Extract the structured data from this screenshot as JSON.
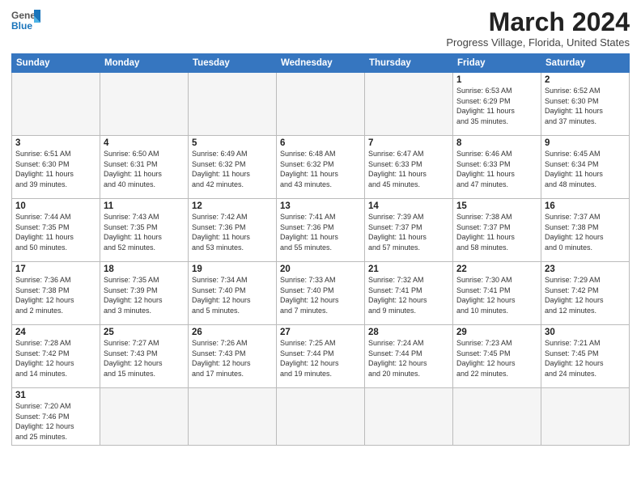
{
  "header": {
    "logo_line1": "General",
    "logo_line2": "Blue",
    "month_title": "March 2024",
    "subtitle": "Progress Village, Florida, United States"
  },
  "columns": [
    "Sunday",
    "Monday",
    "Tuesday",
    "Wednesday",
    "Thursday",
    "Friday",
    "Saturday"
  ],
  "weeks": [
    [
      {
        "day": "",
        "info": ""
      },
      {
        "day": "",
        "info": ""
      },
      {
        "day": "",
        "info": ""
      },
      {
        "day": "",
        "info": ""
      },
      {
        "day": "",
        "info": ""
      },
      {
        "day": "1",
        "info": "Sunrise: 6:53 AM\nSunset: 6:29 PM\nDaylight: 11 hours\nand 35 minutes."
      },
      {
        "day": "2",
        "info": "Sunrise: 6:52 AM\nSunset: 6:30 PM\nDaylight: 11 hours\nand 37 minutes."
      }
    ],
    [
      {
        "day": "3",
        "info": "Sunrise: 6:51 AM\nSunset: 6:30 PM\nDaylight: 11 hours\nand 39 minutes."
      },
      {
        "day": "4",
        "info": "Sunrise: 6:50 AM\nSunset: 6:31 PM\nDaylight: 11 hours\nand 40 minutes."
      },
      {
        "day": "5",
        "info": "Sunrise: 6:49 AM\nSunset: 6:32 PM\nDaylight: 11 hours\nand 42 minutes."
      },
      {
        "day": "6",
        "info": "Sunrise: 6:48 AM\nSunset: 6:32 PM\nDaylight: 11 hours\nand 43 minutes."
      },
      {
        "day": "7",
        "info": "Sunrise: 6:47 AM\nSunset: 6:33 PM\nDaylight: 11 hours\nand 45 minutes."
      },
      {
        "day": "8",
        "info": "Sunrise: 6:46 AM\nSunset: 6:33 PM\nDaylight: 11 hours\nand 47 minutes."
      },
      {
        "day": "9",
        "info": "Sunrise: 6:45 AM\nSunset: 6:34 PM\nDaylight: 11 hours\nand 48 minutes."
      }
    ],
    [
      {
        "day": "10",
        "info": "Sunrise: 7:44 AM\nSunset: 7:35 PM\nDaylight: 11 hours\nand 50 minutes."
      },
      {
        "day": "11",
        "info": "Sunrise: 7:43 AM\nSunset: 7:35 PM\nDaylight: 11 hours\nand 52 minutes."
      },
      {
        "day": "12",
        "info": "Sunrise: 7:42 AM\nSunset: 7:36 PM\nDaylight: 11 hours\nand 53 minutes."
      },
      {
        "day": "13",
        "info": "Sunrise: 7:41 AM\nSunset: 7:36 PM\nDaylight: 11 hours\nand 55 minutes."
      },
      {
        "day": "14",
        "info": "Sunrise: 7:39 AM\nSunset: 7:37 PM\nDaylight: 11 hours\nand 57 minutes."
      },
      {
        "day": "15",
        "info": "Sunrise: 7:38 AM\nSunset: 7:37 PM\nDaylight: 11 hours\nand 58 minutes."
      },
      {
        "day": "16",
        "info": "Sunrise: 7:37 AM\nSunset: 7:38 PM\nDaylight: 12 hours\nand 0 minutes."
      }
    ],
    [
      {
        "day": "17",
        "info": "Sunrise: 7:36 AM\nSunset: 7:38 PM\nDaylight: 12 hours\nand 2 minutes."
      },
      {
        "day": "18",
        "info": "Sunrise: 7:35 AM\nSunset: 7:39 PM\nDaylight: 12 hours\nand 3 minutes."
      },
      {
        "day": "19",
        "info": "Sunrise: 7:34 AM\nSunset: 7:40 PM\nDaylight: 12 hours\nand 5 minutes."
      },
      {
        "day": "20",
        "info": "Sunrise: 7:33 AM\nSunset: 7:40 PM\nDaylight: 12 hours\nand 7 minutes."
      },
      {
        "day": "21",
        "info": "Sunrise: 7:32 AM\nSunset: 7:41 PM\nDaylight: 12 hours\nand 9 minutes."
      },
      {
        "day": "22",
        "info": "Sunrise: 7:30 AM\nSunset: 7:41 PM\nDaylight: 12 hours\nand 10 minutes."
      },
      {
        "day": "23",
        "info": "Sunrise: 7:29 AM\nSunset: 7:42 PM\nDaylight: 12 hours\nand 12 minutes."
      }
    ],
    [
      {
        "day": "24",
        "info": "Sunrise: 7:28 AM\nSunset: 7:42 PM\nDaylight: 12 hours\nand 14 minutes."
      },
      {
        "day": "25",
        "info": "Sunrise: 7:27 AM\nSunset: 7:43 PM\nDaylight: 12 hours\nand 15 minutes."
      },
      {
        "day": "26",
        "info": "Sunrise: 7:26 AM\nSunset: 7:43 PM\nDaylight: 12 hours\nand 17 minutes."
      },
      {
        "day": "27",
        "info": "Sunrise: 7:25 AM\nSunset: 7:44 PM\nDaylight: 12 hours\nand 19 minutes."
      },
      {
        "day": "28",
        "info": "Sunrise: 7:24 AM\nSunset: 7:44 PM\nDaylight: 12 hours\nand 20 minutes."
      },
      {
        "day": "29",
        "info": "Sunrise: 7:23 AM\nSunset: 7:45 PM\nDaylight: 12 hours\nand 22 minutes."
      },
      {
        "day": "30",
        "info": "Sunrise: 7:21 AM\nSunset: 7:45 PM\nDaylight: 12 hours\nand 24 minutes."
      }
    ],
    [
      {
        "day": "31",
        "info": "Sunrise: 7:20 AM\nSunset: 7:46 PM\nDaylight: 12 hours\nand 25 minutes."
      },
      {
        "day": "",
        "info": ""
      },
      {
        "day": "",
        "info": ""
      },
      {
        "day": "",
        "info": ""
      },
      {
        "day": "",
        "info": ""
      },
      {
        "day": "",
        "info": ""
      },
      {
        "day": "",
        "info": ""
      }
    ]
  ]
}
